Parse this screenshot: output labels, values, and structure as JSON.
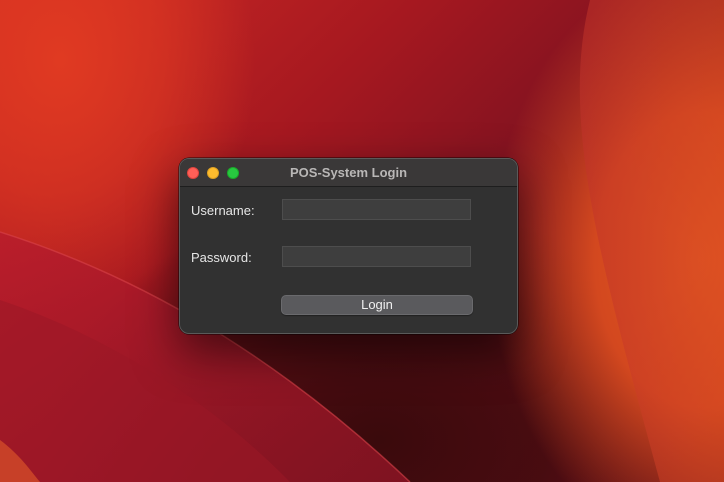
{
  "window": {
    "title": "POS-System Login"
  },
  "form": {
    "username_label": "Username:",
    "username_value": "",
    "password_label": "Password:",
    "password_value": "",
    "login_label": "Login"
  },
  "colors": {
    "close": "#fe5f57",
    "minimize": "#febc2e",
    "zoom": "#28c840",
    "window_bg": "#313131",
    "button_bg": "#5a5a5d"
  }
}
